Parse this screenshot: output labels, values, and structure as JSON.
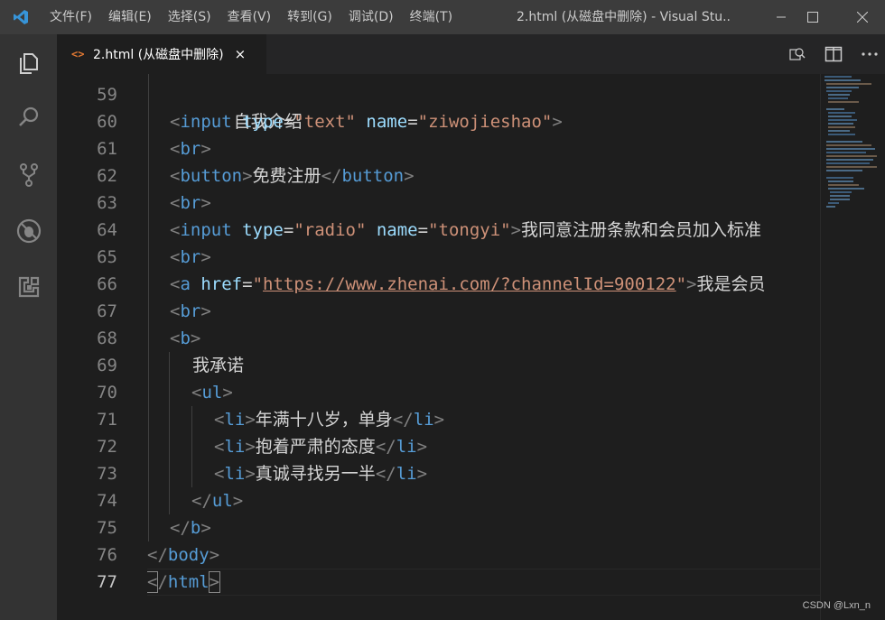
{
  "menu": [
    "文件(F)",
    "编辑(E)",
    "选择(S)",
    "查看(V)",
    "转到(G)",
    "调试(D)",
    "终端(T)"
  ],
  "window_title": "2.html (从磁盘中删除) - Visual Stu...",
  "tab": {
    "icon": "<>",
    "label": "2.html (从磁盘中删除)",
    "close": "×"
  },
  "icons": {
    "app": "vscode-logo-icon",
    "activity": [
      "explorer-icon",
      "search-icon",
      "source-control-icon",
      "debug-icon",
      "extensions-icon"
    ],
    "window": [
      "minimize-icon",
      "maximize-icon",
      "close-window-icon"
    ],
    "tab_actions": [
      "open-changes-icon",
      "split-editor-icon",
      "more-actions-icon"
    ]
  },
  "colors": {
    "tag": "#569cd6",
    "attr": "#9cdcfe",
    "string": "#ce9178",
    "bracket": "#808080",
    "text": "#d4d4d4",
    "background": "#1e1e1e"
  },
  "editor": {
    "line_numbers": [
      "59",
      "60",
      "61",
      "62",
      "63",
      "64",
      "65",
      "66",
      "67",
      "68",
      "69",
      "70",
      "71",
      "72",
      "73",
      "74",
      "75",
      "76",
      "77"
    ],
    "active_line": "77",
    "lines": {
      "l59": {
        "t1": "自我介绍"
      },
      "l60": {
        "lt": "<",
        "tag": "input",
        "a1": "type",
        "eq1": "=",
        "v1": "\"text\"",
        "a2": "name",
        "eq2": "=",
        "v2": "\"ziwojieshao\"",
        "gt": ">"
      },
      "l61": {
        "lt": "<",
        "tag": "br",
        "gt": ">"
      },
      "l62": {
        "lt": "<",
        "tag": "button",
        "gt": ">",
        "text": "免费注册",
        "lt2": "</",
        "tag2": "button",
        "gt2": ">"
      },
      "l63": {
        "lt": "<",
        "tag": "br",
        "gt": ">"
      },
      "l64": {
        "lt": "<",
        "tag": "input",
        "a1": "type",
        "eq1": "=",
        "v1": "\"radio\"",
        "a2": "name",
        "eq2": "=",
        "v2": "\"tongyi\"",
        "gt": ">",
        "text": "我同意注册条款和会员加入标准"
      },
      "l65": {
        "lt": "<",
        "tag": "br",
        "gt": ">"
      },
      "l66": {
        "lt": "<",
        "tag": "a",
        "a1": "href",
        "eq1": "=",
        "q1": "\"",
        "url": "https://www.zhenai.com/?channelId=900122",
        "q2": "\"",
        "gt": ">",
        "text": "我是会员"
      },
      "l67": {
        "lt": "<",
        "tag": "br",
        "gt": ">"
      },
      "l68": {
        "lt": "<",
        "tag": "b",
        "gt": ">"
      },
      "l69": {
        "t1": "我承诺"
      },
      "l70": {
        "lt": "<",
        "tag": "ul",
        "gt": ">"
      },
      "l71": {
        "lt": "<",
        "tag": "li",
        "gt": ">",
        "text": "年满十八岁，单身",
        "lt2": "</",
        "tag2": "li",
        "gt2": ">"
      },
      "l72": {
        "lt": "<",
        "tag": "li",
        "gt": ">",
        "text": "抱着严肃的态度",
        "lt2": "</",
        "tag2": "li",
        "gt2": ">"
      },
      "l73": {
        "lt": "<",
        "tag": "li",
        "gt": ">",
        "text": "真诚寻找另一半",
        "lt2": "</",
        "tag2": "li",
        "gt2": ">"
      },
      "l74": {
        "lt": "</",
        "tag": "ul",
        "gt": ">"
      },
      "l75": {
        "lt": "</",
        "tag": "b",
        "gt": ">"
      },
      "l76": {
        "lt": "</",
        "tag": "body",
        "gt": ">"
      },
      "l77": {
        "lt": "<",
        "slash": "/",
        "tag": "html",
        "gt": ">"
      }
    }
  },
  "watermark": "CSDN @Lxn_n"
}
